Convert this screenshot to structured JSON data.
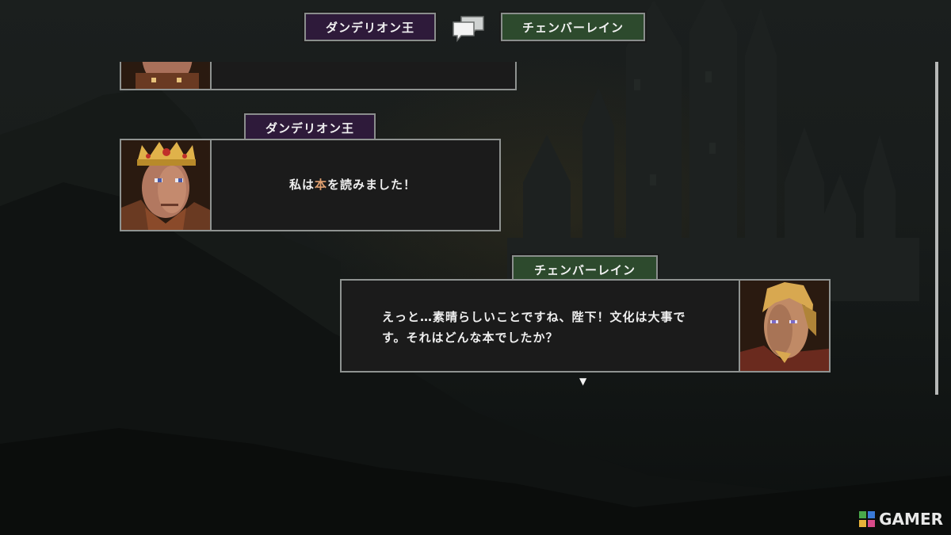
{
  "header": {
    "speaker_left": "ダンデリオン王",
    "speaker_right": "チェンバーレイン",
    "conversation_icon": "speech-bubbles-icon"
  },
  "log": [
    {
      "speaker": "",
      "text": ""
    },
    {
      "speaker": "ダンデリオン王",
      "text_before": "私は",
      "text_highlight": "本",
      "text_after": "を読みました！"
    },
    {
      "speaker": "チェンバーレイン",
      "line1": "えっと…素晴らしいことですね、陛下！文化は大事で",
      "line2": "す。それはどんな本でしたか？"
    }
  ],
  "advance_indicator": "▼",
  "watermark": {
    "text": "GAMER"
  },
  "colors": {
    "king_plate": "#2e1a3a",
    "chamberlain_plate": "#2d4a2d",
    "highlight": "#e0a070"
  }
}
